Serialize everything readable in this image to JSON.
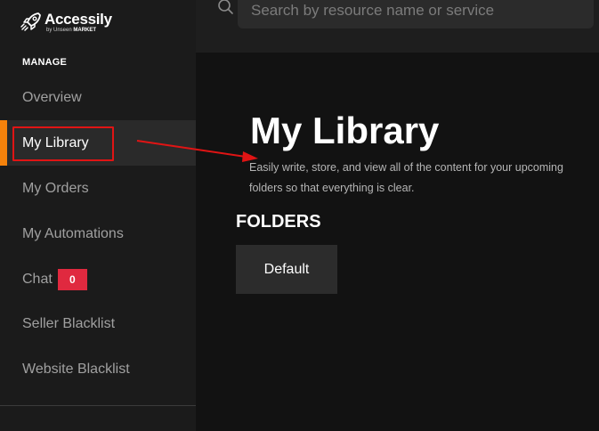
{
  "brand": {
    "name": "Accessily",
    "sub_prefix": "by Unseen",
    "sub_bold": "MARKET"
  },
  "sidebar": {
    "section_title": "MANAGE",
    "items": [
      {
        "label": "Overview"
      },
      {
        "label": "My Library",
        "active": true
      },
      {
        "label": "My Orders"
      },
      {
        "label": "My Automations"
      },
      {
        "label": "Chat",
        "badge": "0"
      },
      {
        "label": "Seller Blacklist"
      },
      {
        "label": "Website Blacklist"
      }
    ]
  },
  "search": {
    "placeholder": "Search by resource name or service",
    "value": ""
  },
  "main": {
    "title": "My Library",
    "description_line1": "Easily write, store, and view all of the content for your upcoming",
    "description_line2": "folders so that everything is clear.",
    "folders_heading": "FOLDERS",
    "folders": [
      {
        "label": "Default"
      }
    ]
  },
  "colors": {
    "accent": "#f5820b",
    "highlight_annotation": "#e01414",
    "badge": "#e0293f",
    "sidebar_bg": "#1b1b1b",
    "main_bg": "#121212"
  },
  "icons": {
    "logo": "rocket-icon",
    "search": "search-icon"
  }
}
